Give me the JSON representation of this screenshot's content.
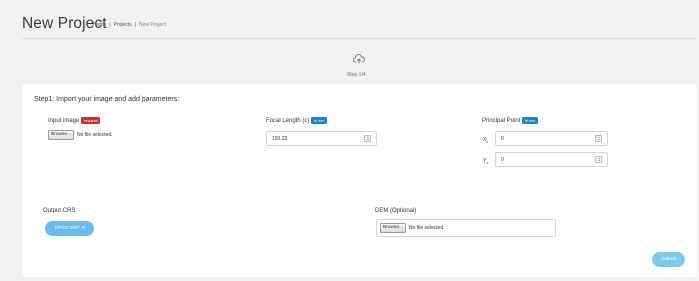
{
  "header": {
    "title": "New Project",
    "breadcrumb": [
      {
        "label": "Home"
      },
      {
        "label": "Projects"
      },
      {
        "label": "New Project"
      }
    ],
    "separator": "|"
  },
  "wizard": {
    "icon": "cloud-upload-icon",
    "step_label": "Step 1/4"
  },
  "form": {
    "title": "Step1: Import your image and add parameters:",
    "input_image": {
      "label": "Input image",
      "badge": "required",
      "browse_label": "Browse...",
      "file_status": "No file selected."
    },
    "focal_length": {
      "label": "Focal Length (c)",
      "unit_badge": "In mm",
      "value": "150.23"
    },
    "principal_point": {
      "label": "Principal Point",
      "unit_badge": "In mm",
      "x_label": "X",
      "x_sub": "o",
      "x_value": "0",
      "y_label": "Y",
      "y_sub": "o",
      "y_value": "0"
    },
    "output_crs": {
      "label": "Output CRS",
      "button": "EPSG 3857",
      "caret": "▾"
    },
    "dem": {
      "label": "DEM (Optional)",
      "browse_label": "Browse...",
      "file_status": "No file selected."
    },
    "submit_label": "Submit"
  },
  "colors": {
    "background": "#f1f1f1",
    "required_badge": "#c9302c",
    "unit_badge": "#1b84c6",
    "crs_button": "#6bbcec",
    "submit_button": "#7ec8ea"
  }
}
